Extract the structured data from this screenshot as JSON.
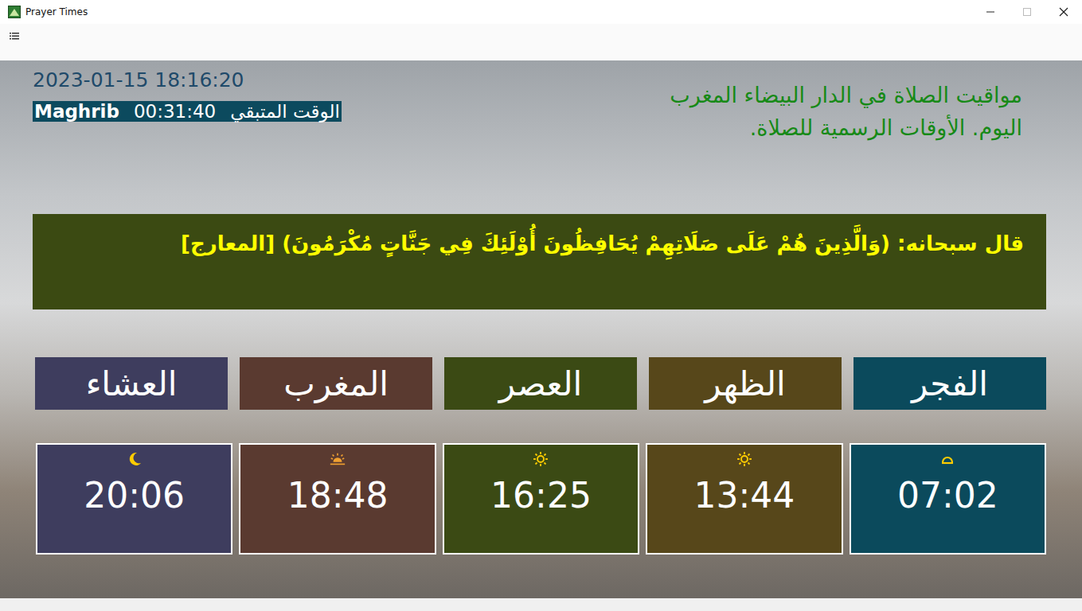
{
  "window": {
    "title": "Prayer Times"
  },
  "header": {
    "datetime": "2023-01-15 18:16:20",
    "countdown": {
      "prayer": "Maghrib",
      "remaining": "00:31:40",
      "label": "الوقت المتبقي"
    },
    "heading_lines": [
      "مواقيت الصلاة في  الدار البيضاء المغرب",
      "اليوم. الأوقات الرسمية للصلاة."
    ]
  },
  "quote": "قال سبحانه: (وَالَّذِينَ هُمْ عَلَى صَلَاتِهِمْ يُحَافِظُونَ  أُوْلَئِكَ فِي جَنَّاتٍ مُكْرَمُونَ) [المعارج]",
  "prayers": [
    {
      "name": "الفجر",
      "time": "07:02",
      "color": "#0b4a5c",
      "kind": "sunrise"
    },
    {
      "name": "الظهر",
      "time": "13:44",
      "color": "#57471a",
      "kind": "sun"
    },
    {
      "name": "العصر",
      "time": "16:25",
      "color": "#3b4a14",
      "kind": "sun"
    },
    {
      "name": "المغرب",
      "time": "18:48",
      "color": "#5a3a30",
      "kind": "sunset"
    },
    {
      "name": "العشاء",
      "time": "20:06",
      "color": "#3e3d5e",
      "kind": "moon"
    }
  ]
}
